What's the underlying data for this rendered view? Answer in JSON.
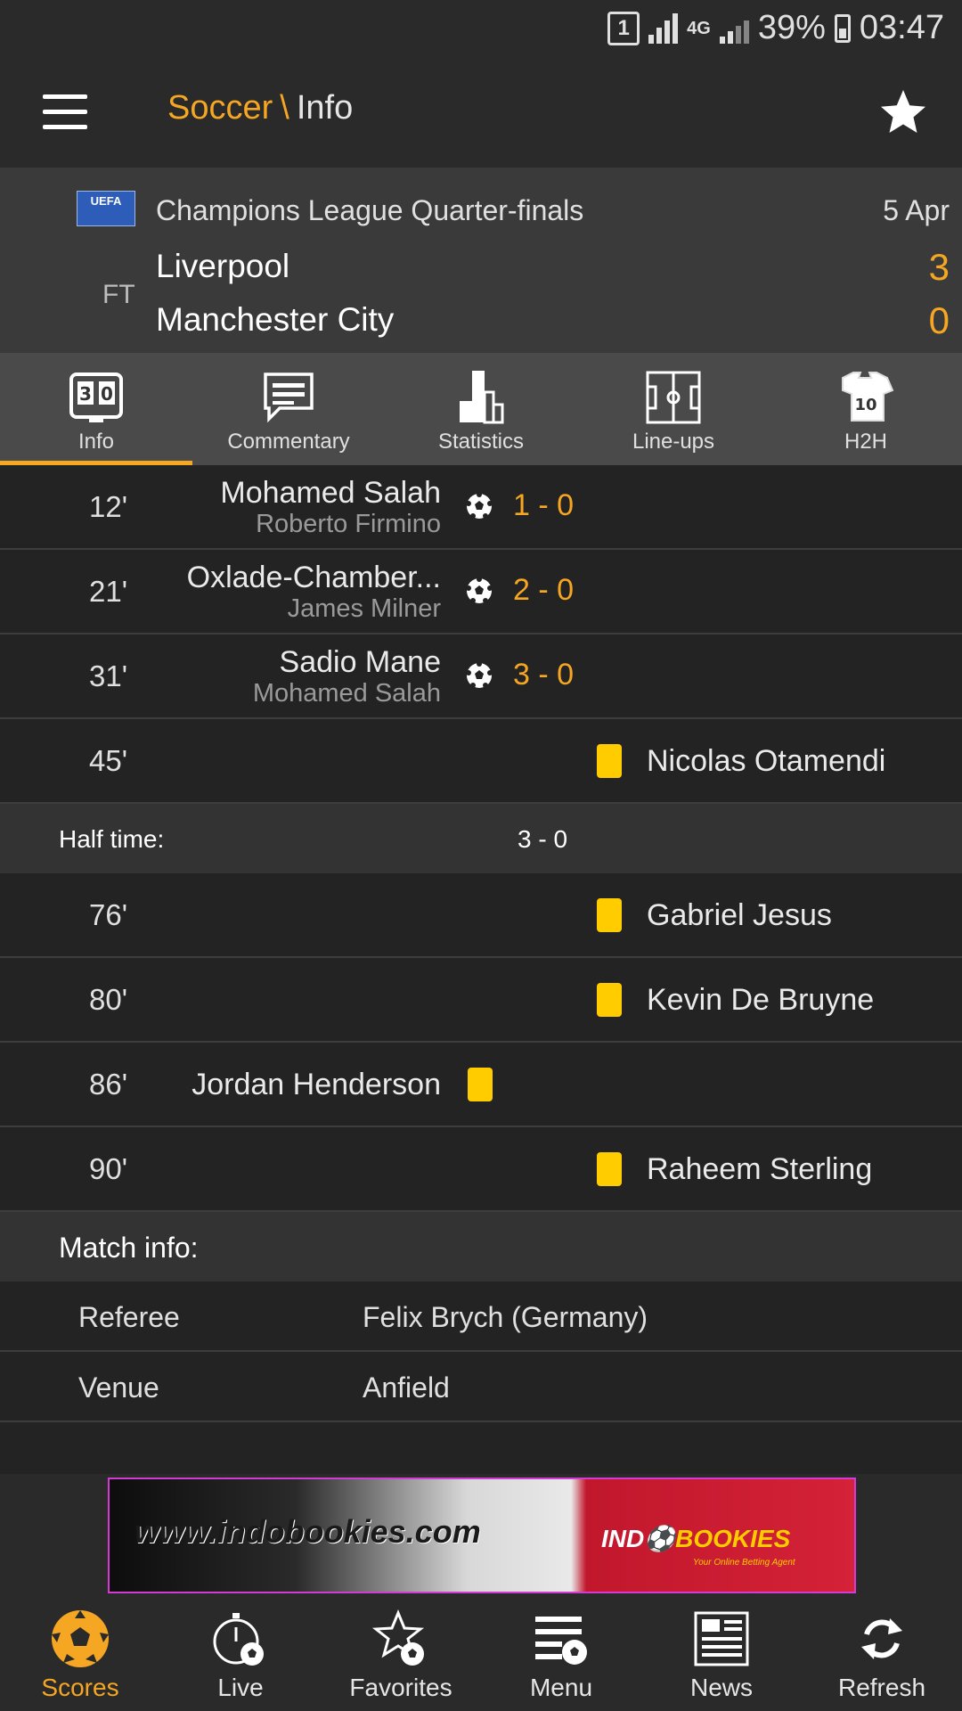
{
  "status_bar": {
    "sim": "1",
    "network": "4G",
    "battery": "39%",
    "time": "03:47"
  },
  "header": {
    "section": "Soccer",
    "separator": "\\",
    "page": "Info"
  },
  "match": {
    "uefa_logo_text": "UEFA",
    "competition": "Champions League Quarter-finals",
    "date": "5 Apr",
    "status": "FT",
    "home_team": "Liverpool",
    "away_team": "Manchester City",
    "home_score": "3",
    "away_score": "0"
  },
  "tabs": [
    {
      "label": "Info",
      "icon": "scoreboard-icon",
      "active": true
    },
    {
      "label": "Commentary",
      "icon": "comment-icon"
    },
    {
      "label": "Statistics",
      "icon": "statistics-icon"
    },
    {
      "label": "Line-ups",
      "icon": "pitch-icon"
    },
    {
      "label": "H2H",
      "icon": "shirts-icon"
    }
  ],
  "goals": [
    {
      "minute": "12'",
      "scorer": "Mohamed Salah",
      "assist": "Roberto Firmino",
      "score": "1 - 0"
    },
    {
      "minute": "21'",
      "scorer": "Oxlade-Chamber...",
      "assist": "James Milner",
      "score": "2 - 0"
    },
    {
      "minute": "31'",
      "scorer": "Sadio Mane",
      "assist": "Mohamed Salah",
      "score": "3 - 0"
    }
  ],
  "cards_first_half": [
    {
      "minute": "45'",
      "player": "Nicolas Otamendi",
      "side": "away",
      "type": "yellow"
    }
  ],
  "half_time": {
    "label": "Half time:",
    "score": "3 - 0"
  },
  "cards_second_half": [
    {
      "minute": "76'",
      "player": "Gabriel Jesus",
      "side": "away",
      "type": "yellow"
    },
    {
      "minute": "80'",
      "player": "Kevin De Bruyne",
      "side": "away",
      "type": "yellow"
    },
    {
      "minute": "86'",
      "player": "Jordan Henderson",
      "side": "home",
      "type": "yellow"
    },
    {
      "minute": "90'",
      "player": "Raheem Sterling",
      "side": "away",
      "type": "yellow"
    }
  ],
  "match_info": {
    "heading": "Match info:",
    "rows": [
      {
        "key": "Referee",
        "value": "Felix Brych (Germany)"
      },
      {
        "key": "Venue",
        "value": "Anfield"
      }
    ]
  },
  "ad": {
    "url": "www.indobookies.com",
    "brand_part1": "IND",
    "brand_part2": "BOOKIES",
    "tagline": "Your Online Betting Agent"
  },
  "bottom_nav": [
    {
      "label": "Scores",
      "icon": "soccer-ball-icon",
      "active": true
    },
    {
      "label": "Live",
      "icon": "stopwatch-icon"
    },
    {
      "label": "Favorites",
      "icon": "star-ball-icon"
    },
    {
      "label": "Menu",
      "icon": "menu-ball-icon"
    },
    {
      "label": "News",
      "icon": "newspaper-icon"
    },
    {
      "label": "Refresh",
      "icon": "refresh-icon"
    }
  ],
  "colors": {
    "accent": "#f5a623",
    "card_yellow": "#ffcc00",
    "background": "#232323",
    "header_bg": "#3a3a3a"
  }
}
